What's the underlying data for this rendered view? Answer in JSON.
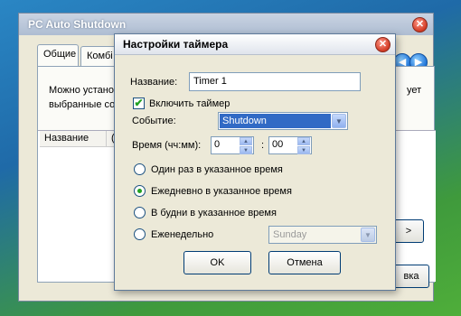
{
  "background_window": {
    "title": "PC Auto Shutdown",
    "tabs": [
      "Общие",
      "Комбі"
    ],
    "nav_buttons": [
      "◀",
      "▶"
    ],
    "text_line1_left": "Можно устано",
    "text_line1_right": "ует",
    "text_line2_left": "выбранные со",
    "columns": [
      "Название",
      "("
    ],
    "right_button_partial": ">",
    "bottom_right_button_partial": "вка"
  },
  "dialog": {
    "title": "Настройки таймера",
    "name_label": "Название:",
    "name_value": "Timer 1",
    "enable_label": "Включить таймер",
    "enable_checked": true,
    "event_label": "Событие:",
    "event_value": "Shutdown",
    "time_label": "Время (чч:мм):",
    "hours": "0",
    "separator": ":",
    "minutes": "00",
    "options": [
      {
        "label": "Один раз в указанное время",
        "selected": false
      },
      {
        "label": "Ежедневно в указанное время",
        "selected": true
      },
      {
        "label": "В будни в указанное время",
        "selected": false
      },
      {
        "label": "Еженедельно",
        "selected": false
      }
    ],
    "weekday_value": "Sunday",
    "ok_label": "OK",
    "cancel_label": "Отмена"
  },
  "icons": {
    "close": "close-icon",
    "dropdown": "chevron-down-icon",
    "spin_up": "spin-up-icon",
    "spin_down": "spin-down-icon",
    "check": "checkmark-icon"
  },
  "colors": {
    "selection_blue": "#316ac5",
    "check_green": "#21a121",
    "close_red": "#d23a24"
  }
}
